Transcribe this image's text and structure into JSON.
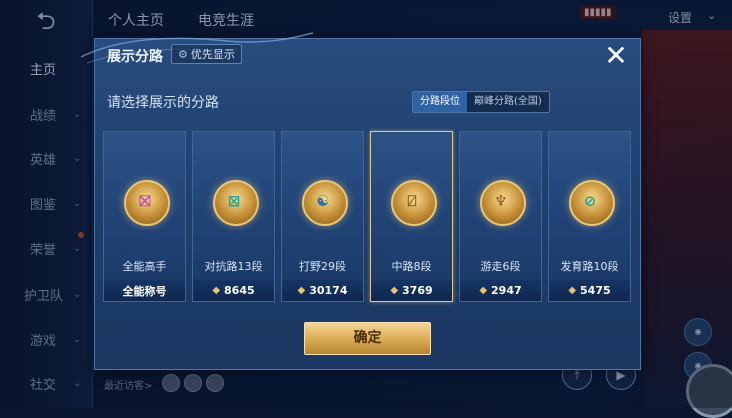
{
  "sidebar": {
    "back_icon": "back-arrow-icon",
    "items": [
      {
        "label": "主页",
        "active": true
      },
      {
        "label": "战绩"
      },
      {
        "label": "英雄"
      },
      {
        "label": "图鉴"
      },
      {
        "label": "荣誉"
      },
      {
        "label": "护卫队"
      },
      {
        "label": "游戏"
      },
      {
        "label": "社交"
      }
    ]
  },
  "header": {
    "tabs": [
      "个人主页",
      "电竞生涯"
    ],
    "settings_label": "设置"
  },
  "footer": {
    "recent_visitors": "最近访客>"
  },
  "modal": {
    "title": "展示分路",
    "priority_label": "优先显示",
    "close_icon": "close-icon",
    "subtitle": "请选择展示的分路",
    "segments": [
      {
        "label": "分路段位",
        "selected": true
      },
      {
        "label": "巅峰分路(全国)",
        "selected": false
      }
    ],
    "cards": [
      {
        "name": "全能高手",
        "stat": "全能称号",
        "icon": "all-round-emblem-icon",
        "glyph": "⛝",
        "glyph_color": "#c24fb0",
        "show_stat_icon": false
      },
      {
        "name": "对抗路13段",
        "stat": "8645",
        "icon": "clash-lane-emblem-icon",
        "glyph": "⊠",
        "glyph_color": "#1fa59a",
        "show_stat_icon": true
      },
      {
        "name": "打野29段",
        "stat": "30174",
        "icon": "jungle-emblem-icon",
        "glyph": "☯",
        "glyph_color": "#2f6fb8",
        "show_stat_icon": true
      },
      {
        "name": "中路8段",
        "stat": "3769",
        "icon": "mid-lane-emblem-icon",
        "glyph": "⍁",
        "glyph_color": "#8a5a16",
        "show_stat_icon": true,
        "selected": true
      },
      {
        "name": "游走6段",
        "stat": "2947",
        "icon": "roam-emblem-icon",
        "glyph": "♆",
        "glyph_color": "#8a5a16",
        "show_stat_icon": true
      },
      {
        "name": "发育路10段",
        "stat": "5475",
        "icon": "farm-lane-emblem-icon",
        "glyph": "⊘",
        "glyph_color": "#1fa59a",
        "show_stat_icon": true
      }
    ],
    "confirm_label": "确定"
  },
  "colors": {
    "accent_gold": "#d8aa52",
    "modal_bg": "#284c7e",
    "segment_active": "#2f63a6"
  }
}
